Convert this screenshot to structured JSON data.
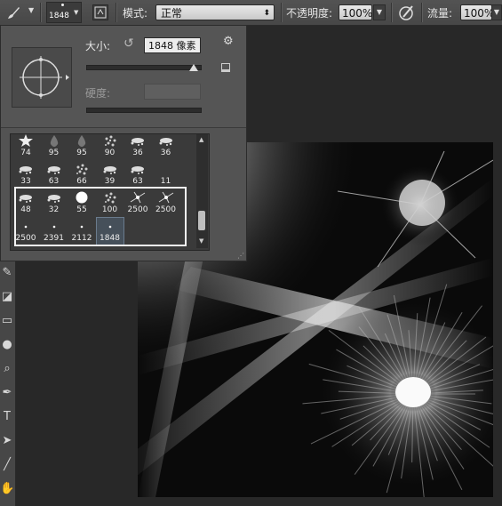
{
  "options_bar": {
    "brush_size_value": "1848",
    "mode_label": "模式:",
    "mode_value": "正常",
    "opacity_label": "不透明度:",
    "opacity_value": "100%",
    "flow_label": "流量:",
    "flow_value": "100%"
  },
  "brush_panel": {
    "size_label": "大小:",
    "size_value": "1848 像素",
    "hardness_label": "硬度:",
    "size_slider_fraction": 0.94
  },
  "brush_presets": [
    {
      "size": "74",
      "shape": "star"
    },
    {
      "size": "95",
      "shape": "drop"
    },
    {
      "size": "95",
      "shape": "drop"
    },
    {
      "size": "90",
      "shape": "texture"
    },
    {
      "size": "36",
      "shape": "splat"
    },
    {
      "size": "36",
      "shape": "splat"
    },
    {
      "size": "33",
      "shape": "splat"
    },
    {
      "size": "63",
      "shape": "splat"
    },
    {
      "size": "66",
      "shape": "texture"
    },
    {
      "size": "39",
      "shape": "splat"
    },
    {
      "size": "63",
      "shape": "splat"
    },
    {
      "size": "11",
      "shape": "blank"
    },
    {
      "size": "48",
      "shape": "splat"
    },
    {
      "size": "32",
      "shape": "splat"
    },
    {
      "size": "55",
      "shape": "soft-round"
    },
    {
      "size": "100",
      "shape": "texture"
    },
    {
      "size": "2500",
      "shape": "burst"
    },
    {
      "size": "2500",
      "shape": "burst"
    },
    {
      "size": "2500",
      "shape": "dot"
    },
    {
      "size": "2391",
      "shape": "dot"
    },
    {
      "size": "2112",
      "shape": "dot"
    },
    {
      "size": "1848",
      "shape": "dot",
      "selected": true
    }
  ],
  "tools": [
    "brush-tool",
    "eraser-tool",
    "gradient-tool",
    "blur-tool",
    "dodge-tool",
    "pen-tool",
    "type-tool",
    "path-selection-tool",
    "line-tool",
    "hand-tool"
  ],
  "tool_glyphs": [
    "✎",
    "◪",
    "▭",
    "●",
    "⌕",
    "✒",
    "T",
    "➤",
    "╱",
    "✋"
  ],
  "colors": {
    "ui_bg": "#535353",
    "dark_bg": "#282828",
    "highlight_box": "#f2f2f2"
  }
}
